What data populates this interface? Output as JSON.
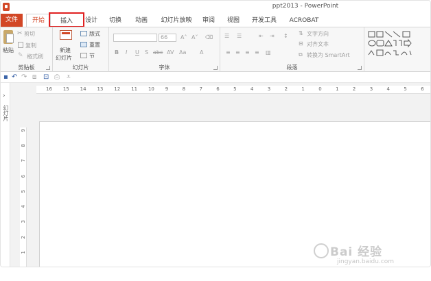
{
  "window": {
    "title": "ppt2013 - PowerPoint"
  },
  "tabs": [
    "文件",
    "开始",
    "插入",
    "设计",
    "切换",
    "动画",
    "幻灯片放映",
    "审阅",
    "视图",
    "开发工具",
    "ACROBAT"
  ],
  "ribbon": {
    "clipboard": {
      "paste": "粘贴",
      "cut": "剪切",
      "copy": "复制",
      "format_painter": "格式刷",
      "label": "剪贴板"
    },
    "slides": {
      "new_slide_line1": "新建",
      "new_slide_line2": "幻灯片",
      "layout": "版式",
      "reset": "重置",
      "section": "节",
      "label": "幻灯片"
    },
    "font": {
      "size": "66",
      "label": "字体"
    },
    "paragraph": {
      "text_direction": "文字方向",
      "align_text": "对齐文本",
      "smartart": "转换为 SmartArt",
      "label": "段落"
    }
  },
  "colors": {
    "accent": "#d24726",
    "highlight": "#e02020"
  },
  "ruler": {
    "horizontal": [
      "16",
      "15",
      "14",
      "13",
      "12",
      "11",
      "10",
      "9",
      "8",
      "7",
      "6",
      "5",
      "4",
      "3",
      "2",
      "1",
      "0",
      "1",
      "2",
      "3",
      "4",
      "5",
      "6"
    ],
    "vertical": [
      "9",
      "8",
      "7",
      "6",
      "5",
      "4",
      "3",
      "2",
      "1"
    ]
  },
  "left_pane": {
    "label": "幻灯片"
  },
  "watermark": {
    "brand": "Bai 经验",
    "url": "jingyan.baidu.com"
  }
}
